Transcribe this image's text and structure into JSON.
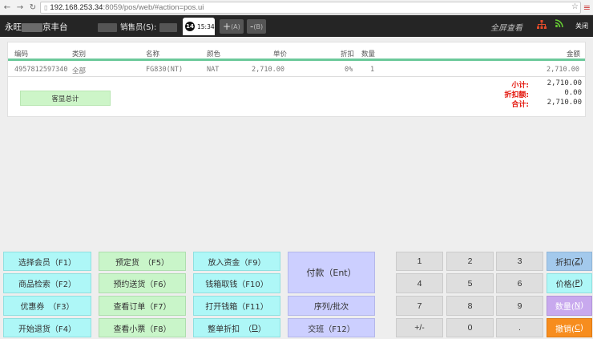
{
  "browser": {
    "url_host": "192.168.253.34",
    "url_path": ":8059/pos/web/#action=pos.ui"
  },
  "header": {
    "store_prefix": "永旺",
    "store_suffix": "京丰台",
    "seller_label": "销售员(S):",
    "clock_badge": "14",
    "clock_time": "15:34",
    "add_label": "+",
    "add_key": "(A)",
    "remove_label": "-",
    "remove_key": "(B)",
    "fullscreen": "全屏查看",
    "close": "关闭",
    "colors": {
      "bar": "#252525",
      "tree_icon": "#e14a2a",
      "rss_icon": "#66cc33"
    }
  },
  "table": {
    "columns": {
      "code": "编码",
      "category": "类别",
      "name": "名称",
      "color": "颜色",
      "unit_price": "单价",
      "discount": "折扣",
      "qty": "数量",
      "amount": "金额"
    },
    "rows": [
      {
        "code": "4957812597340",
        "category": "全部",
        "name": "FG830(NT)",
        "color": "NAT",
        "unit_price": "2,710.00",
        "discount": "0%",
        "qty": "1",
        "amount": "2,710.00"
      }
    ]
  },
  "summary": {
    "button": "客显总计",
    "subtotal_label": "小计:",
    "subtotal": "2,710.00",
    "discount_label": "折扣额:",
    "discount": "0.00",
    "total_label": "合计:",
    "total": "2,710.00",
    "label_color": "#e3170d"
  },
  "pad": {
    "col1": [
      "选择会员（F1）",
      "商品检索（F2）",
      "优惠券　（F3）",
      "开始退货（F4）"
    ],
    "col2": [
      "预定货　（F5）",
      "预约送货（F6）",
      "查看订单（F7）",
      "查看小票（F8）"
    ],
    "col3": [
      "放入资金（F9）",
      "钱箱取钱（F10）",
      "打开钱箱（F11）",
      "整单折扣　（",
      "D",
      "）"
    ],
    "pay": "付款（Ent）",
    "serial": "序列/批次",
    "shift": "交班（F12）",
    "numbers": [
      "1",
      "2",
      "3",
      "4",
      "5",
      "6",
      "7",
      "8",
      "9",
      "+/-",
      "0",
      "."
    ],
    "discount_btn": "折扣(",
    "discount_key": "Z",
    "discount_end": ")",
    "price_btn": "价格(",
    "price_key": "P",
    "price_end": ")",
    "qty_btn": "数量(",
    "qty_key": "N",
    "qty_end": ")",
    "cancel_btn": "撤销(",
    "cancel_key": "C",
    "cancel_end": ")",
    "colors": {
      "cyan": "#aef7f7",
      "green": "#c9f5c9",
      "lavender": "#cccfff",
      "blue": "#a3c9ec",
      "purple": "#c8a9ee",
      "orange": "#f78d1e",
      "pink": "#f1a7d0"
    }
  }
}
